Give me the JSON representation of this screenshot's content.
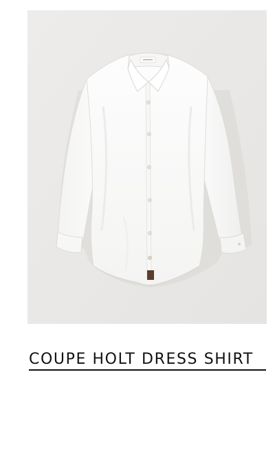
{
  "product": {
    "title": "COUPE HOLT DRESS SHIRT",
    "image_icon": "white-dress-shirt"
  },
  "colors": {
    "page_background": "#ffffff",
    "image_background": "#ebe9e7",
    "text": "#111111"
  }
}
